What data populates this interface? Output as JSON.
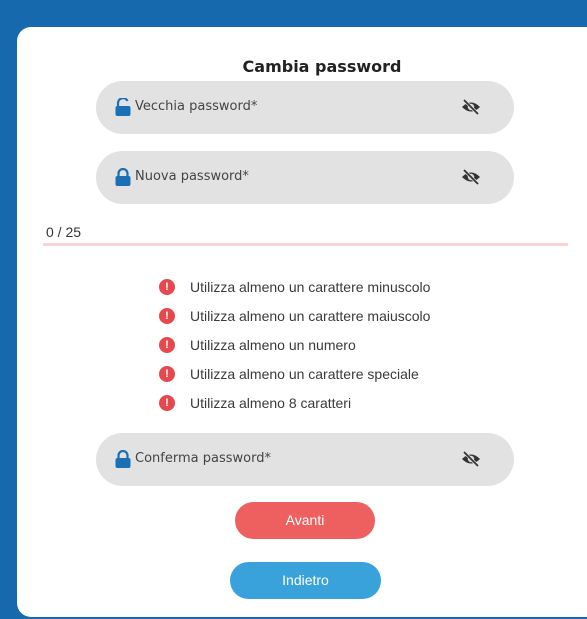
{
  "dialog": {
    "title": "Cambia password"
  },
  "fields": {
    "old_password": {
      "label": "Vecchia password*",
      "lock_state": "unlocked",
      "eye": "eye-off-icon"
    },
    "new_password": {
      "label": "Nuova password*",
      "lock_state": "locked",
      "eye": "eye-off-icon"
    },
    "confirm_password": {
      "label": "Conferma password*",
      "lock_state": "locked",
      "eye": "eye-off-icon"
    }
  },
  "strength": {
    "counter": "0 / 25",
    "value": 0,
    "max": 25
  },
  "rules": [
    {
      "text": "Utilizza almeno un carattere minuscolo",
      "status": "error"
    },
    {
      "text": "Utilizza almeno un carattere maiuscolo",
      "status": "error"
    },
    {
      "text": "Utilizza almeno un numero",
      "status": "error"
    },
    {
      "text": "Utilizza almeno un carattere speciale",
      "status": "error"
    },
    {
      "text": "Utilizza almeno 8 caratteri",
      "status": "error"
    }
  ],
  "buttons": {
    "next_label": "Avanti",
    "back_label": "Indietro"
  },
  "colors": {
    "background": "#1669ad",
    "lock_icon": "#1a6fb5",
    "error": "#e5484d",
    "next_button": "#ee5f60",
    "back_button": "#3aa2da"
  }
}
